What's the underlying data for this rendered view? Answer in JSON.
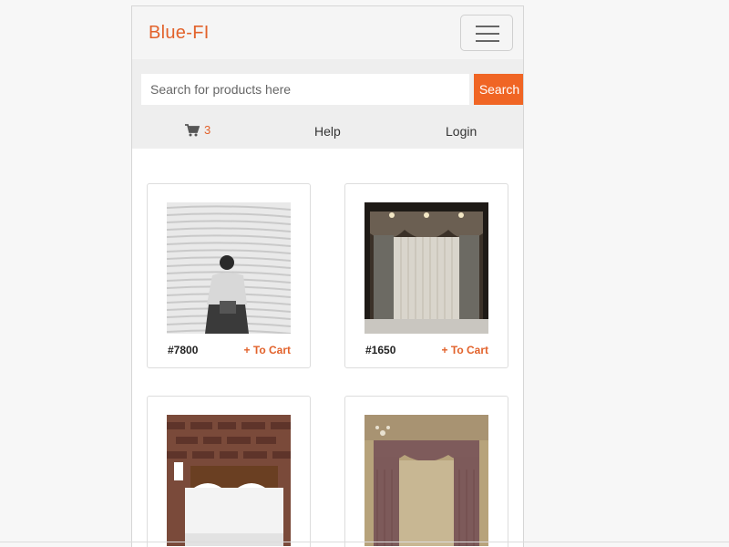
{
  "header": {
    "brand": "Blue-FI"
  },
  "search": {
    "placeholder": "Search for products here",
    "button_label": "Search"
  },
  "subnav": {
    "cart_count": "3",
    "help_label": "Help",
    "login_label": "Login"
  },
  "products": [
    {
      "id": "#7800",
      "action": "+ To Cart"
    },
    {
      "id": "#1650",
      "action": "+ To Cart"
    },
    {
      "id": "",
      "action": ""
    },
    {
      "id": "",
      "action": ""
    }
  ],
  "colors": {
    "accent": "#f06524",
    "brand": "#e2622b"
  }
}
